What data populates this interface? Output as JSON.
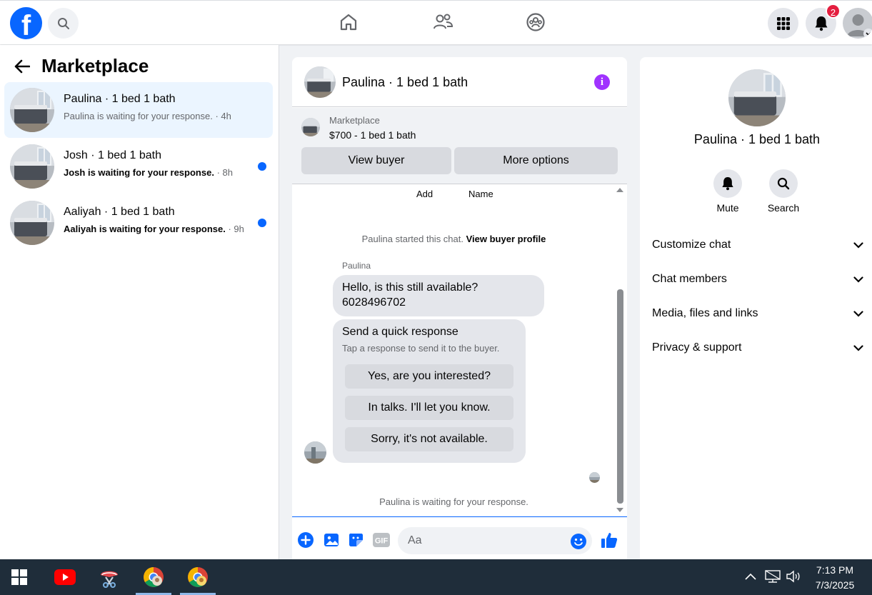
{
  "topbar": {
    "logo": "f",
    "notification_count": "2",
    "icons": [
      "facebook-logo",
      "search-icon",
      "home-icon",
      "friends-icon",
      "groups-icon",
      "menu-grid-icon",
      "bell-icon",
      "account-avatar"
    ]
  },
  "left_panel": {
    "title": "Marketplace",
    "conversations": [
      {
        "name": "Paulina · 1 bed 1 bath",
        "message": "Paulina is waiting for your response.",
        "time": "· 4h",
        "unread": false
      },
      {
        "name": "Josh · 1 bed 1 bath",
        "message": "Josh is waiting for your response.",
        "time": "· 8h",
        "unread": true
      },
      {
        "name": "Aaliyah · 1 bed 1 bath",
        "message": "Aaliyah is waiting for your response.",
        "time": "· 9h",
        "unread": true
      }
    ]
  },
  "chat": {
    "title": "Paulina · 1 bed 1 bath",
    "info_icon": "i",
    "listing": {
      "category": "Marketplace",
      "price_title": "$700 - 1 bed 1 bath"
    },
    "view_buyer_label": "View buyer",
    "more_options_label": "More options",
    "top_labels": {
      "add": "Add",
      "name": "Name"
    },
    "started_text": "Paulina started this chat.",
    "view_profile_link": "View buyer profile",
    "sender_name": "Paulina",
    "message_line1": "Hello, is this still available?",
    "message_line2": "6028496702",
    "quick_response": {
      "title": "Send a quick response",
      "subtitle": "Tap a response to send it to the buyer.",
      "options": [
        "Yes, are you interested?",
        "In talks. I'll let you know.",
        "Sorry, it's not available."
      ]
    },
    "waiting_text": "Paulina is waiting for your response.",
    "composer_placeholder": "Aa",
    "gif_label": "GIF"
  },
  "right_panel": {
    "name": "Paulina · 1 bed 1 bath",
    "mute_label": "Mute",
    "search_label": "Search",
    "sections": [
      "Customize chat",
      "Chat members",
      "Media, files and links",
      "Privacy & support"
    ]
  },
  "taskbar": {
    "time": "7:13 PM",
    "date": "7/3/2025"
  },
  "colors": {
    "brand_blue": "#0866ff",
    "notification_red": "#e41e3f",
    "info_purple": "#a033ff",
    "taskbar": "#1f2d3a"
  }
}
